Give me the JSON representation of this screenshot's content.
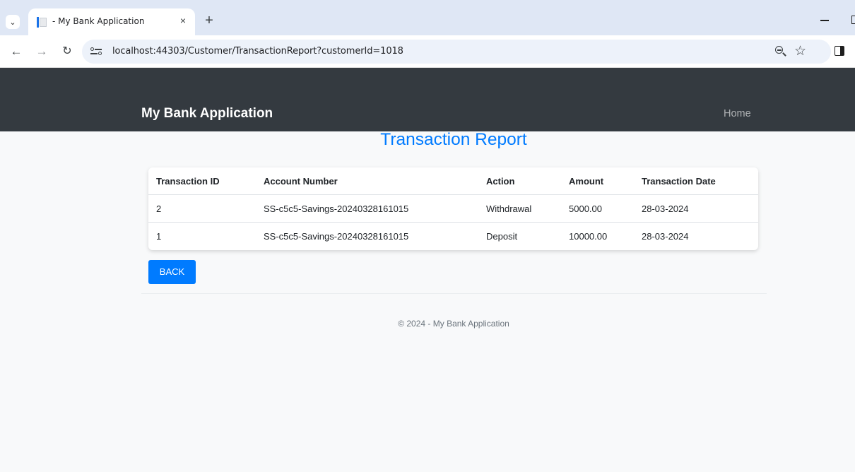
{
  "browser": {
    "tab_title": "- My Bank Application",
    "tab_close": "×",
    "new_tab": "+",
    "url": "localhost:44303/Customer/TransactionReport?customerId=1018"
  },
  "navbar": {
    "brand": "My Bank Application",
    "home_link": "Home"
  },
  "page": {
    "title": "Transaction Report",
    "back_button": "BACK",
    "footer": "© 2024 - My Bank Application"
  },
  "table": {
    "headers": [
      "Transaction ID",
      "Account Number",
      "Action",
      "Amount",
      "Transaction Date"
    ],
    "rows": [
      [
        "2",
        "SS-c5c5-Savings-20240328161015",
        "Withdrawal",
        "5000.00",
        "28-03-2024"
      ],
      [
        "1",
        "SS-c5c5-Savings-20240328161015",
        "Deposit",
        "10000.00",
        "28-03-2024"
      ]
    ]
  },
  "colors": {
    "navbar": "#343a40",
    "accent": "#007bff",
    "page_background": "#f8f9fa"
  }
}
